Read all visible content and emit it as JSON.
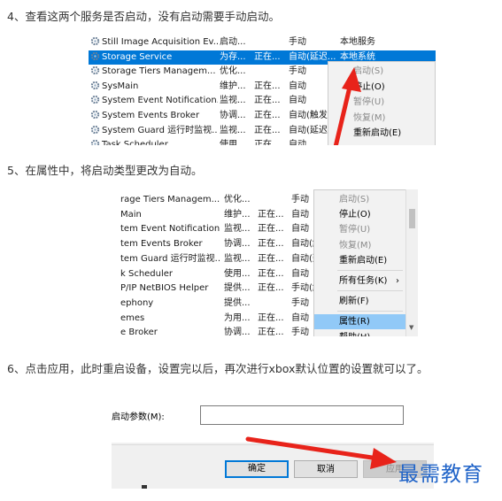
{
  "steps": [
    {
      "title": "4、查看这两个服务是否启动，没有启动需要手动启动。"
    },
    {
      "title": "5、在属性中，将启动类型更改为自动。"
    },
    {
      "title": "6、点击应用，此时重启设备，设置完以后，再次进行xbox默认位置的设置就可以了。"
    }
  ],
  "shot1": {
    "rows": [
      {
        "name": "Still Image Acquisition Ev...",
        "desc": "启动...",
        "status": "",
        "startup": "手动",
        "logon": "本地服务"
      },
      {
        "name": "Storage Service",
        "desc": "为存...",
        "status": "正在...",
        "startup": "自动(延迟...",
        "logon": "本地系统",
        "selected": true
      },
      {
        "name": "Storage Tiers Managem...",
        "desc": "优化...",
        "status": "",
        "startup": "手动",
        "logon": ""
      },
      {
        "name": "SysMain",
        "desc": "维护...",
        "status": "正在...",
        "startup": "自动",
        "logon": ""
      },
      {
        "name": "System Event Notification...",
        "desc": "监视...",
        "status": "正在...",
        "startup": "自动",
        "logon": ""
      },
      {
        "name": "System Events Broker",
        "desc": "协调...",
        "status": "正在...",
        "startup": "自动(触发...",
        "logon": ""
      },
      {
        "name": "System Guard 运行时监视...",
        "desc": "监视...",
        "status": "正在...",
        "startup": "自动(延迟...",
        "logon": ""
      },
      {
        "name": "Task Scheduler",
        "desc": "使用...",
        "status": "正在...",
        "startup": "自动",
        "logon": ""
      }
    ],
    "menu": [
      {
        "label": "启动(S)",
        "disabled": true
      },
      {
        "label": "停止(O)",
        "disabled": false
      },
      {
        "label": "暂停(U)",
        "disabled": true
      },
      {
        "label": "恢复(M)",
        "disabled": true
      },
      {
        "label": "重新启动(E)",
        "disabled": false
      }
    ]
  },
  "shot2": {
    "rows": [
      {
        "name": "rage Tiers Managem...",
        "desc": "优化...",
        "status": "",
        "startup": "手动"
      },
      {
        "name": "Main",
        "desc": "维护...",
        "status": "正在...",
        "startup": "自动"
      },
      {
        "name": "tem Event Notification...",
        "desc": "监视...",
        "status": "正在...",
        "startup": "自动"
      },
      {
        "name": "tem Events Broker",
        "desc": "协调...",
        "status": "正在...",
        "startup": "自动(触发..."
      },
      {
        "name": "tem Guard 运行时监视...",
        "desc": "监视...",
        "status": "正在...",
        "startup": "自动(延迟..."
      },
      {
        "name": "k Scheduler",
        "desc": "使用...",
        "status": "正在...",
        "startup": "自动"
      },
      {
        "name": "P/IP NetBIOS Helper",
        "desc": "提供...",
        "status": "正在...",
        "startup": "手动(触发..."
      },
      {
        "name": "ephony",
        "desc": "提供...",
        "status": "",
        "startup": "手动"
      },
      {
        "name": "emes",
        "desc": "为用...",
        "status": "正在...",
        "startup": "自动"
      },
      {
        "name": "e Broker",
        "desc": "协调...",
        "status": "正在...",
        "startup": "手动"
      }
    ],
    "menu": [
      {
        "label": "启动(S)",
        "disabled": true
      },
      {
        "label": "停止(O)",
        "disabled": false
      },
      {
        "label": "暂停(U)",
        "disabled": true
      },
      {
        "label": "恢复(M)",
        "disabled": true
      },
      {
        "label": "重新启动(E)",
        "disabled": false
      },
      {
        "label": "所有任务(K)",
        "disabled": false,
        "submenu": "›"
      },
      {
        "label": "刷新(F)",
        "disabled": false
      },
      {
        "label": "属性(R)",
        "disabled": false,
        "highlighted": true
      },
      {
        "label": "帮助(H)",
        "disabled": false
      }
    ]
  },
  "shot3": {
    "param_label": "启动参数(M):",
    "param_value": "",
    "ok_label": "确定",
    "cancel_label": "取消",
    "apply_label": "应用"
  },
  "watermark": "最需教育",
  "colors": {
    "selection": "#0078d7",
    "menu_highlight": "#91c9f7",
    "arrow": "#e8231a",
    "watermark": "#1f63c8"
  }
}
